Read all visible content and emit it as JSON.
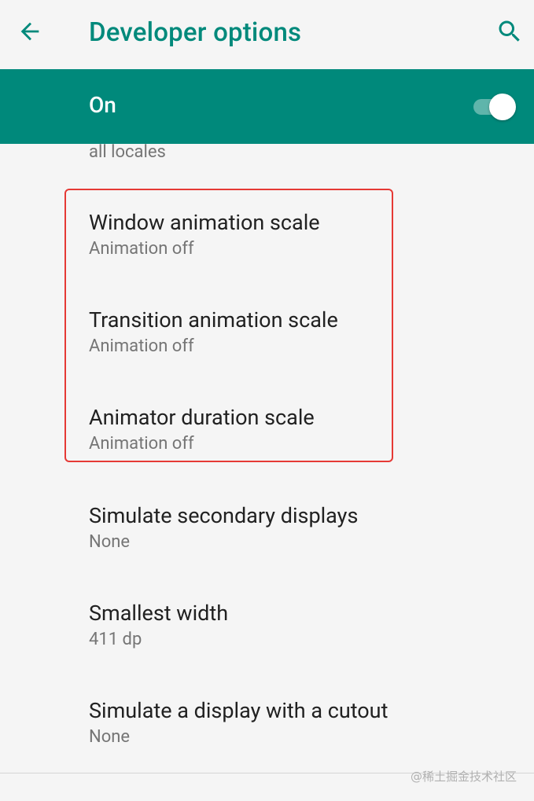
{
  "appbar": {
    "title": "Developer options",
    "back_icon": "arrow-back-icon",
    "search_icon": "search-icon"
  },
  "master_switch": {
    "label": "On",
    "checked": true
  },
  "list": {
    "partial_summary": "all locales",
    "items": [
      {
        "title": "Window animation scale",
        "summary": "Animation off"
      },
      {
        "title": "Transition animation scale",
        "summary": "Animation off"
      },
      {
        "title": "Animator duration scale",
        "summary": "Animation off"
      },
      {
        "title": "Simulate secondary displays",
        "summary": "None"
      },
      {
        "title": "Smallest width",
        "summary": "411 dp"
      },
      {
        "title": "Simulate a display with a cutout",
        "summary": "None"
      }
    ]
  },
  "watermark": "@稀土掘金技术社区",
  "colors": {
    "accent": "#00897b",
    "background": "#f5f5f5",
    "highlight": "#e53935"
  }
}
